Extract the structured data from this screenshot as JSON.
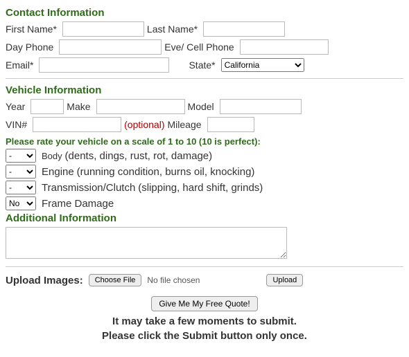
{
  "sections": {
    "contact": "Contact Information",
    "vehicle": "Vehicle Information",
    "additional": "Additional Information"
  },
  "contact": {
    "first_name": "First Name*",
    "last_name": "Last Name*",
    "day_phone": "Day Phone",
    "eve_phone": "Eve/ Cell Phone",
    "email": "Email*",
    "state": "State*",
    "state_value": "California"
  },
  "vehicle": {
    "year": "Year",
    "make": "Make",
    "model": "Model",
    "vin": "VIN#",
    "optional": "(optional)",
    "mileage": "Mileage"
  },
  "rating": {
    "prompt": "Please rate your vehicle on a scale of 1 to 10 (10 is perfect):",
    "body_prefix": "Body",
    "body_desc": "(dents, dings, rust, rot, damage)",
    "engine_prefix": "Engine",
    "engine_desc": "(running condition, burns oil, knocking)",
    "trans_prefix": "Transmission/Clutch",
    "trans_desc": "(slipping, hard shift, grinds)",
    "frame_prefix": "Frame Damage",
    "dash": "-",
    "frame_value": "No"
  },
  "upload": {
    "heading": "Upload Images:",
    "choose": "Choose File",
    "nofile": "No file chosen",
    "upload_btn": "Upload"
  },
  "submit": {
    "button": "Give Me My Free Quote!",
    "note_line1": "It may take a few moments to submit.",
    "note_line2": "Please click the Submit button only once."
  }
}
